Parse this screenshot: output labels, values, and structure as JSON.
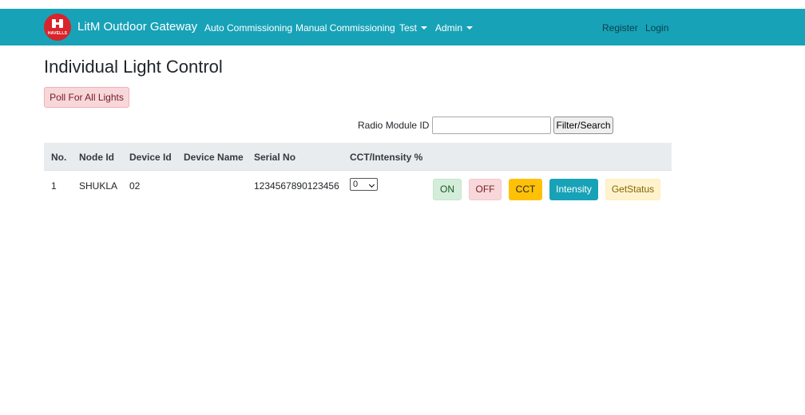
{
  "navbar": {
    "brand_color": "#17a2b8",
    "logo": {
      "text": "HAVELLS",
      "color": "#d8242a"
    },
    "brand": "LitM Outdoor Gateway",
    "links": {
      "auto": "Auto Commissioning",
      "manual": "Manual Commissioning",
      "test": "Test",
      "admin": "Admin"
    },
    "register": "Register",
    "login": "Login"
  },
  "page": {
    "title": "Individual Light Control",
    "poll_button": "Poll For All Lights"
  },
  "filter": {
    "label": "Radio Module ID :",
    "value": "",
    "button": "Filter/Search"
  },
  "table": {
    "headers": {
      "no": "No.",
      "node_id": "Node Id",
      "device_id": "Device Id",
      "device_name": "Device Name",
      "serial_no": "Serial No",
      "cct": "CCT/Intensity %"
    },
    "rows": [
      {
        "no": "1",
        "node_id": "SHUKLA",
        "device_id": "02",
        "device_name": "",
        "serial_no": "1234567890123456",
        "cct_value": "0",
        "actions": {
          "on": "ON",
          "off": "OFF",
          "cct": "CCT",
          "intensity": "Intensity",
          "get_status": "GetStatus"
        }
      }
    ]
  }
}
